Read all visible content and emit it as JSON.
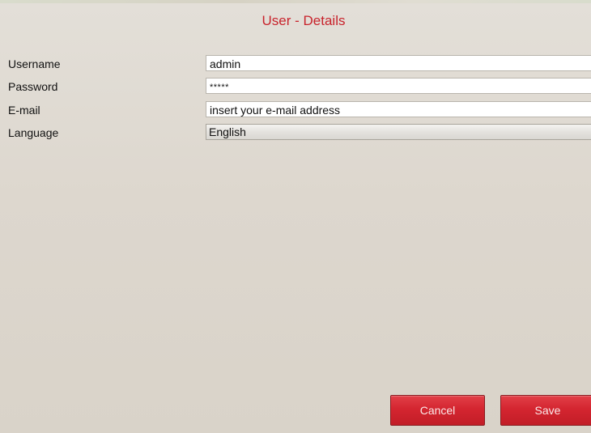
{
  "header": {
    "title": "User - Details"
  },
  "form": {
    "username": {
      "label": "Username",
      "value": "admin"
    },
    "password": {
      "label": "Password",
      "value": "*****"
    },
    "email": {
      "label": "E-mail",
      "value": "insert your e-mail address"
    },
    "language": {
      "label": "Language",
      "selected": "English"
    }
  },
  "buttons": {
    "cancel": "Cancel",
    "save": "Save"
  },
  "colors": {
    "accent": "#c8232c",
    "button": "#d42530",
    "background": "#e0dbd2"
  }
}
